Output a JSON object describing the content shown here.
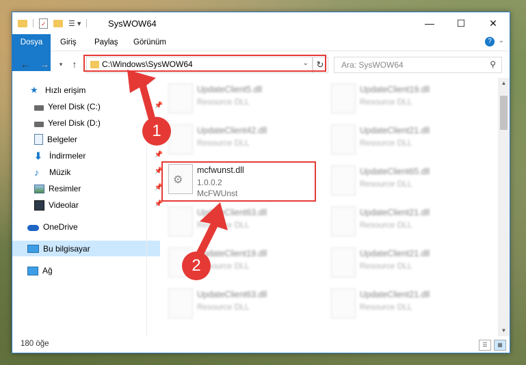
{
  "window": {
    "title": "SysWOW64",
    "controls": {
      "minimize": "—",
      "maximize": "☐",
      "close": "✕"
    }
  },
  "ribbon": {
    "tabs": [
      "Dosya",
      "Giriş",
      "Paylaş",
      "Görünüm"
    ]
  },
  "navigation": {
    "address_path": "C:\\Windows\\SysWOW64",
    "search_placeholder": "Ara: SysWOW64"
  },
  "sidebar": {
    "items": [
      {
        "label": "Hızlı erişim",
        "icon": "star-icon"
      },
      {
        "label": "Yerel Disk (C:)",
        "icon": "drive-icon",
        "pinned": true
      },
      {
        "label": "Yerel Disk (D:)",
        "icon": "drive-icon",
        "pinned": true
      },
      {
        "label": "Belgeler",
        "icon": "documents-icon",
        "pinned": true
      },
      {
        "label": "İndirmeler",
        "icon": "download-icon",
        "pinned": true
      },
      {
        "label": "Müzik",
        "icon": "music-icon",
        "pinned": true
      },
      {
        "label": "Resimler",
        "icon": "pictures-icon",
        "pinned": true
      },
      {
        "label": "Videolar",
        "icon": "videos-icon",
        "pinned": true
      },
      {
        "label": "OneDrive",
        "icon": "cloud-icon"
      },
      {
        "label": "Bu bilgisayar",
        "icon": "computer-icon",
        "selected": true
      },
      {
        "label": "Ağ",
        "icon": "network-icon"
      }
    ]
  },
  "files": {
    "highlighted": {
      "name": "mcfwunst.dll",
      "version": "1.0.0.2",
      "description": "McFWUnst"
    },
    "left_column": [
      {
        "name": "UpdateClient5.dll",
        "type": "Resource DLL"
      },
      {
        "name": "UpdateClient42.dll",
        "type": "Resource DLL"
      },
      {
        "name": "UpdateClient63.dll",
        "type": "Resource DLL"
      },
      {
        "name": "UpdateClient19.dll",
        "type": "Resource DLL"
      },
      {
        "name": "UpdateClient63.dll",
        "type": "Resource DLL"
      }
    ],
    "right_column": [
      {
        "name": "UpdateClient19.dll",
        "type": "Resource DLL"
      },
      {
        "name": "UpdateClient21.dll",
        "type": "Resource DLL"
      },
      {
        "name": "UpdateClient65.dll",
        "type": "Resource DLL"
      },
      {
        "name": "UpdateClient21.dll",
        "type": "Resource DLL"
      },
      {
        "name": "UpdateClient21.dll",
        "type": "Resource DLL"
      },
      {
        "name": "UpdateClient21.dll",
        "type": "Resource DLL"
      }
    ]
  },
  "status": {
    "item_count": "180 öğe"
  },
  "annotations": {
    "step1": "1",
    "step2": "2",
    "color": "#e53935"
  }
}
